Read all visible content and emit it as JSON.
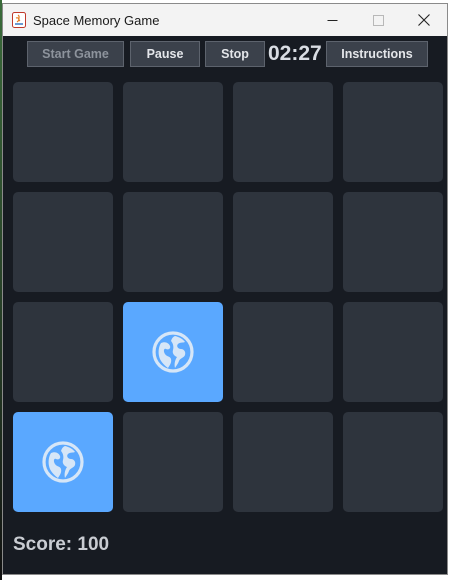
{
  "window": {
    "title": "Space Memory Game"
  },
  "toolbar": {
    "start_label": "Start Game",
    "pause_label": "Pause",
    "stop_label": "Stop",
    "timer": "02:27",
    "instructions_label": "Instructions"
  },
  "board": {
    "rows": 4,
    "cols": 4,
    "cards": [
      {
        "state": "hidden"
      },
      {
        "state": "hidden"
      },
      {
        "state": "hidden"
      },
      {
        "state": "hidden"
      },
      {
        "state": "hidden"
      },
      {
        "state": "hidden"
      },
      {
        "state": "hidden"
      },
      {
        "state": "hidden"
      },
      {
        "state": "hidden"
      },
      {
        "state": "revealed",
        "icon": "globe-icon"
      },
      {
        "state": "hidden"
      },
      {
        "state": "hidden"
      },
      {
        "state": "revealed",
        "icon": "globe-icon"
      },
      {
        "state": "hidden"
      },
      {
        "state": "hidden"
      },
      {
        "state": "hidden"
      }
    ]
  },
  "score": {
    "text": "Score: 100"
  },
  "colors": {
    "background": "#171b22",
    "card_hidden": "#2e343d",
    "card_revealed": "#5aa8ff",
    "button": "#3b414b"
  }
}
